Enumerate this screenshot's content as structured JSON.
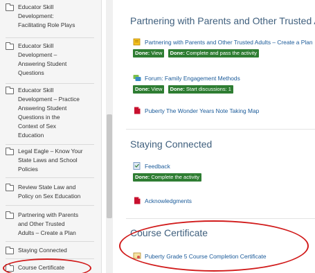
{
  "sidebar": {
    "items": [
      {
        "lines": [
          "Educator Skill",
          "Development:",
          "Facilitating Role Plays"
        ]
      },
      {
        "lines": [
          "Educator Skill",
          "Development –",
          "Answering Student",
          "Questions"
        ]
      },
      {
        "lines": [
          "Educator Skill",
          "Development – Practice",
          "Answering Student",
          "Questions in the",
          "Context of Sex",
          "Education"
        ]
      },
      {
        "lines": [
          "Legal Eagle – Know Your",
          "State Laws and School",
          "Policies"
        ]
      },
      {
        "lines": [
          "Review State Law and",
          "Policy on Sex Education"
        ]
      },
      {
        "lines": [
          "Partnering with Parents",
          "and Other Trusted",
          "Adults – Create a Plan"
        ]
      },
      {
        "lines": [
          "Staying Connected"
        ]
      },
      {
        "lines": [
          "Course Certificate"
        ]
      }
    ]
  },
  "sections": {
    "partnering": {
      "title": "Partnering with Parents and Other Trusted A",
      "act1": {
        "name": "Partnering with Parents and Other Trusted Adults – Create a Plan",
        "b1_label": "Done:",
        "b1_text": "View",
        "b2_label": "Done:",
        "b2_text": "Complete and pass the activity"
      },
      "act2": {
        "name": "Forum: Family Engagement Methods",
        "b1_label": "Done:",
        "b1_text": "View",
        "b2_label": "Done:",
        "b2_text": "Start discussions: 1"
      },
      "act3": {
        "name": "Puberty The Wonder Years Note Taking Map"
      }
    },
    "staying": {
      "title": "Staying Connected",
      "act1": {
        "name": "Feedback",
        "b1_label": "Done:",
        "b1_text": "Complete the activity"
      },
      "act2": {
        "name": "Acknowledgments"
      }
    },
    "certificate": {
      "title": "Course Certificate",
      "act1": {
        "name": "Puberty Grade 5 Course Completion Certificate"
      }
    }
  },
  "colors": {
    "accent": "#1a5a99",
    "done_badge": "#2e7d32",
    "annotation": "#d11a1a"
  }
}
